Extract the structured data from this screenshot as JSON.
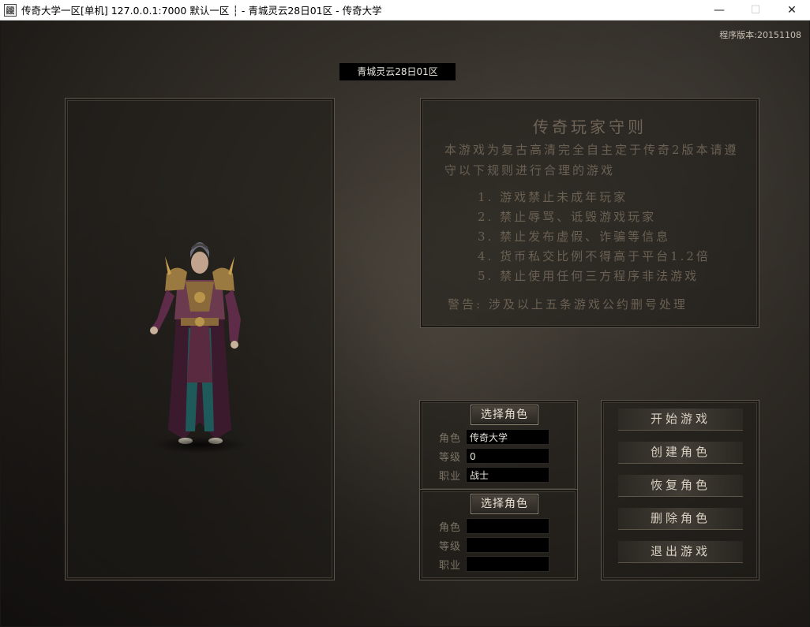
{
  "window": {
    "title": "传奇大学一区[单机] 127.0.0.1:7000  默认一区 ┆ - 青城灵云28日01区 - 传奇大学",
    "icon_glyph": "龖",
    "minimize": "—",
    "maximize": "☐",
    "close": "✕"
  },
  "version": "程序版本:20151108",
  "server_name": "青城灵云28日01区",
  "rules": {
    "title": "传奇玩家守则",
    "intro": "本游戏为复古高清完全自主定于传奇2版本请遵守以下规则进行合理的游戏",
    "items": [
      "1. 游戏禁止未成年玩家",
      "2. 禁止辱骂、诋毁游戏玩家",
      "3. 禁止发布虚假、诈骗等信息",
      "4. 货币私交比例不得高于平台1.2倍",
      "5. 禁止使用任何三方程序非法游戏"
    ],
    "warning": "警告: 涉及以上五条游戏公约删号处理"
  },
  "slot1": {
    "button": "选择角色",
    "role_label": "角色",
    "role": "传奇大学",
    "level_label": "等级",
    "level": "0",
    "job_label": "职业",
    "job": "战士"
  },
  "slot2": {
    "button": "选择角色",
    "role_label": "角色",
    "role": "",
    "level_label": "等级",
    "level": "",
    "job_label": "职业",
    "job": ""
  },
  "actions": {
    "start": "开始游戏",
    "create": "创建角色",
    "restore": "恢复角色",
    "delete": "删除角色",
    "exit": "退出游戏"
  }
}
